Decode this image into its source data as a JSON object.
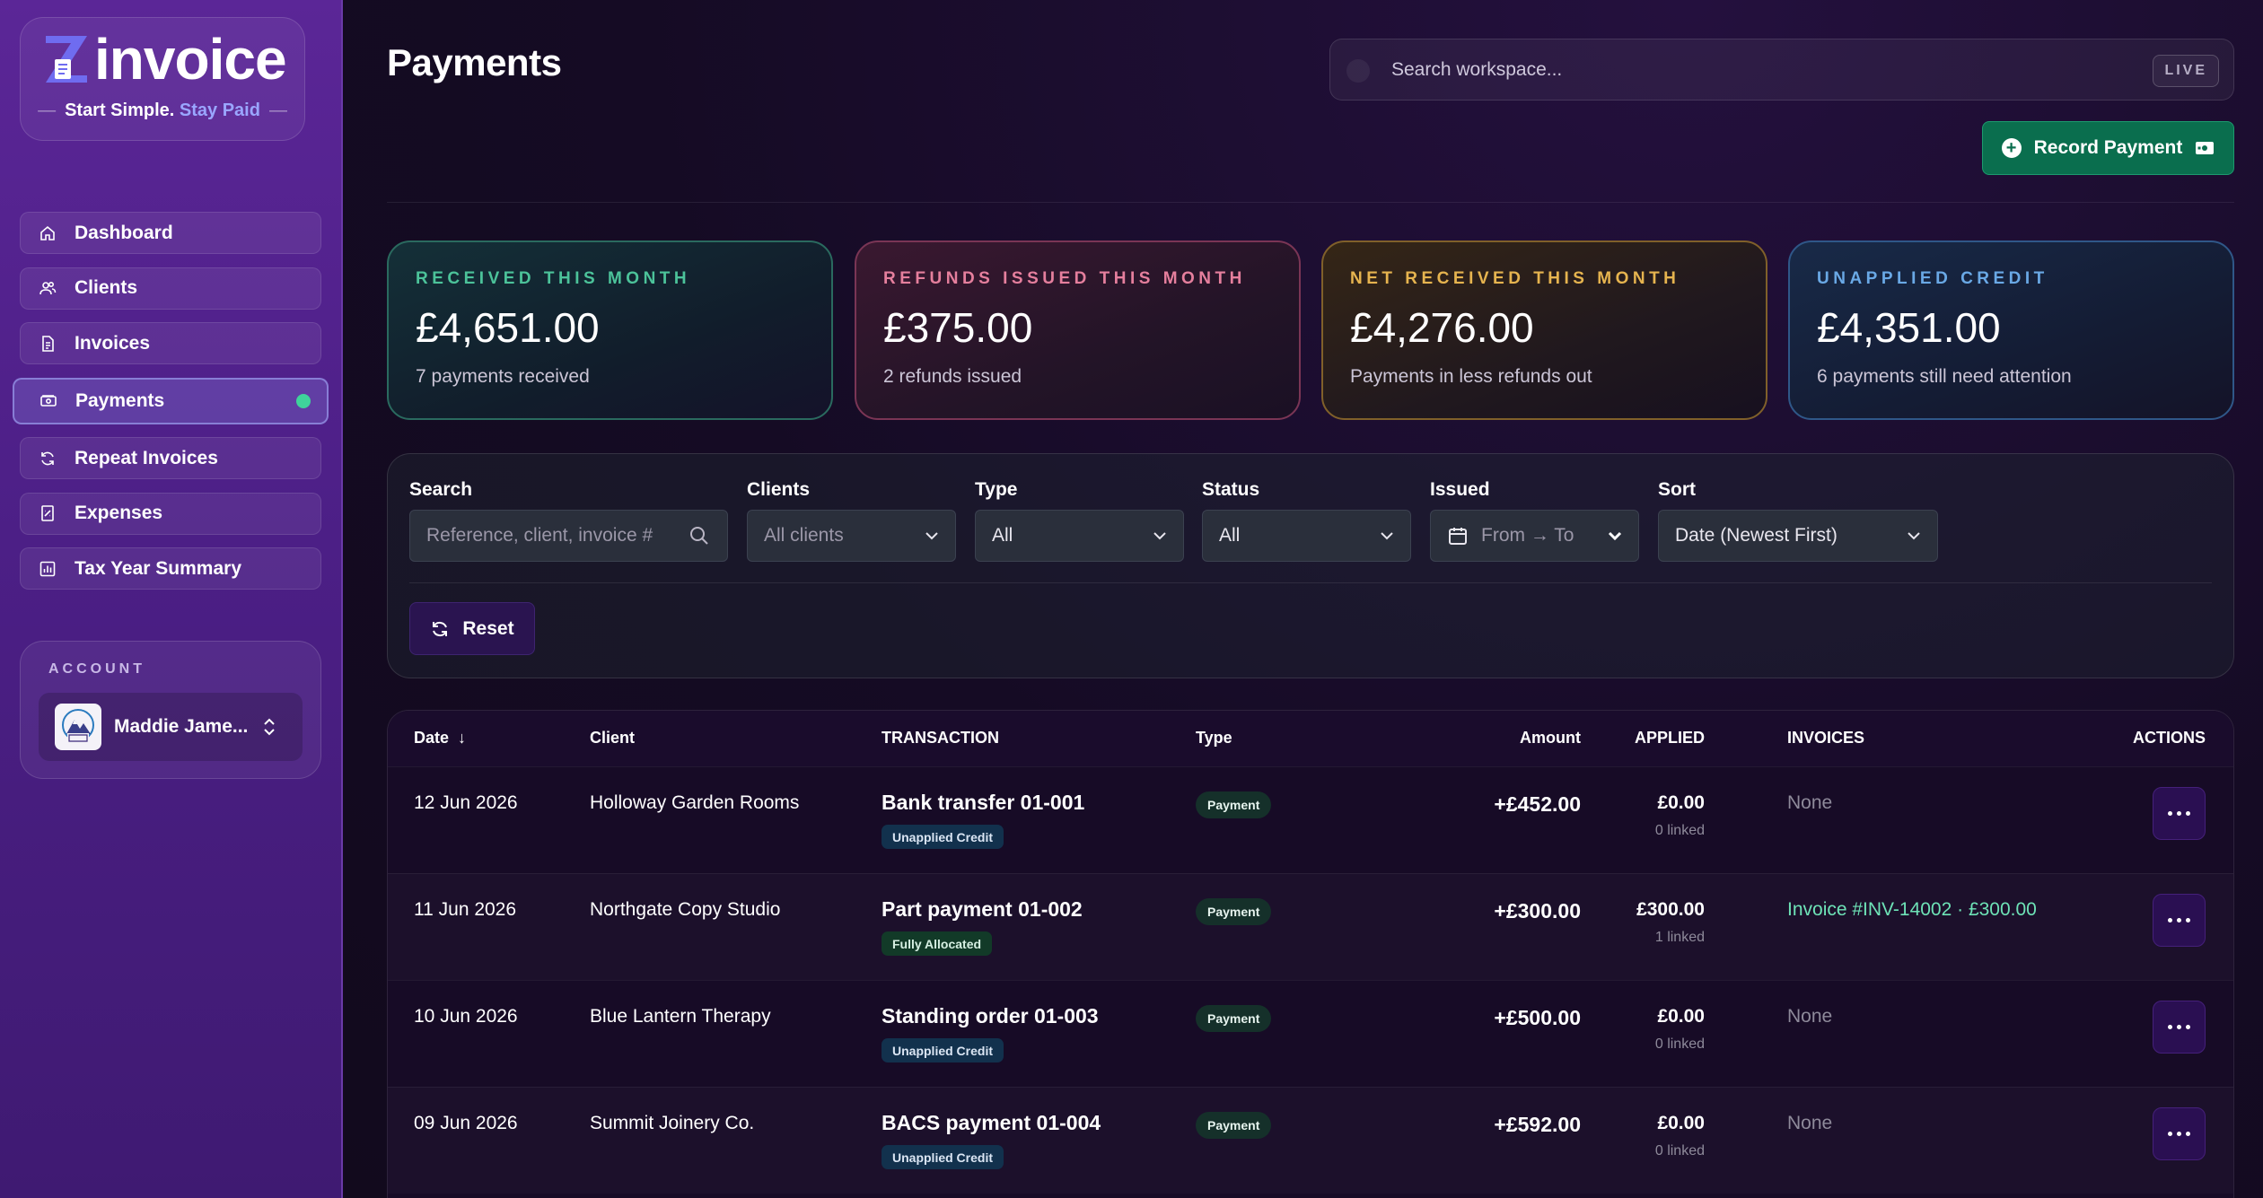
{
  "brand": {
    "logo_text": "invoice",
    "tagline_part1": "Start Simple.",
    "tagline_part2": "Stay Paid"
  },
  "nav": [
    {
      "label": "Dashboard",
      "icon": "home-icon"
    },
    {
      "label": "Clients",
      "icon": "users-icon"
    },
    {
      "label": "Invoices",
      "icon": "invoice-icon"
    },
    {
      "label": "Payments",
      "icon": "payment-icon",
      "active": true
    },
    {
      "label": "Repeat Invoices",
      "icon": "repeat-icon"
    },
    {
      "label": "Expenses",
      "icon": "expense-icon"
    },
    {
      "label": "Tax Year Summary",
      "icon": "chart-icon"
    }
  ],
  "account": {
    "label": "ACCOUNT",
    "name": "Maddie Jame..."
  },
  "header": {
    "title": "Payments",
    "search_placeholder": "Search workspace...",
    "live_badge": "LIVE",
    "record_button": "Record Payment"
  },
  "stats": [
    {
      "label": "RECEIVED THIS MONTH",
      "value": "£4,651.00",
      "sub": "7 payments received"
    },
    {
      "label": "REFUNDS ISSUED THIS MONTH",
      "value": "£375.00",
      "sub": "2 refunds issued"
    },
    {
      "label": "NET RECEIVED THIS MONTH",
      "value": "£4,276.00",
      "sub": "Payments in less refunds out"
    },
    {
      "label": "UNAPPLIED CREDIT",
      "value": "£4,351.00",
      "sub": "6 payments still need attention"
    }
  ],
  "filters": {
    "search": {
      "label": "Search",
      "placeholder": "Reference, client, invoice #"
    },
    "clients": {
      "label": "Clients",
      "value": "All clients"
    },
    "type": {
      "label": "Type",
      "value": "All"
    },
    "status": {
      "label": "Status",
      "value": "All"
    },
    "issued": {
      "label": "Issued",
      "value": "From → To"
    },
    "sort": {
      "label": "Sort",
      "value": "Date (Newest First)"
    },
    "reset_label": "Reset"
  },
  "table": {
    "headers": {
      "date": "Date",
      "date_sort": "↓",
      "client": "Client",
      "transaction": "TRANSACTION",
      "type": "Type",
      "amount": "Amount",
      "applied": "APPLIED",
      "invoices": "INVOICES",
      "actions": "ACTIONS"
    },
    "rows": [
      {
        "date": "12 Jun 2026",
        "client": "Holloway Garden Rooms",
        "transaction": "Bank transfer 01-001",
        "status": "Unapplied Credit",
        "type": "Payment",
        "amount": "+£452.00",
        "applied": "£0.00",
        "linked": "0 linked",
        "invoices": "None"
      },
      {
        "date": "11 Jun 2026",
        "client": "Northgate Copy Studio",
        "transaction": "Part payment 01-002",
        "status": "Fully Allocated",
        "type": "Payment",
        "amount": "+£300.00",
        "applied": "£300.00",
        "linked": "1 linked",
        "invoices": "Invoice #INV-14002 · £300.00"
      },
      {
        "date": "10 Jun 2026",
        "client": "Blue Lantern Therapy",
        "transaction": "Standing order 01-003",
        "status": "Unapplied Credit",
        "type": "Payment",
        "amount": "+£500.00",
        "applied": "£0.00",
        "linked": "0 linked",
        "invoices": "None"
      },
      {
        "date": "09 Jun 2026",
        "client": "Summit Joinery Co.",
        "transaction": "BACS payment 01-004",
        "status": "Unapplied Credit",
        "type": "Payment",
        "amount": "+£592.00",
        "applied": "£0.00",
        "linked": "0 linked",
        "invoices": "None"
      }
    ]
  },
  "colors": {
    "accent": "#9aa6ff",
    "success": "#3fd39b",
    "record_button": "#0a6e4e"
  }
}
